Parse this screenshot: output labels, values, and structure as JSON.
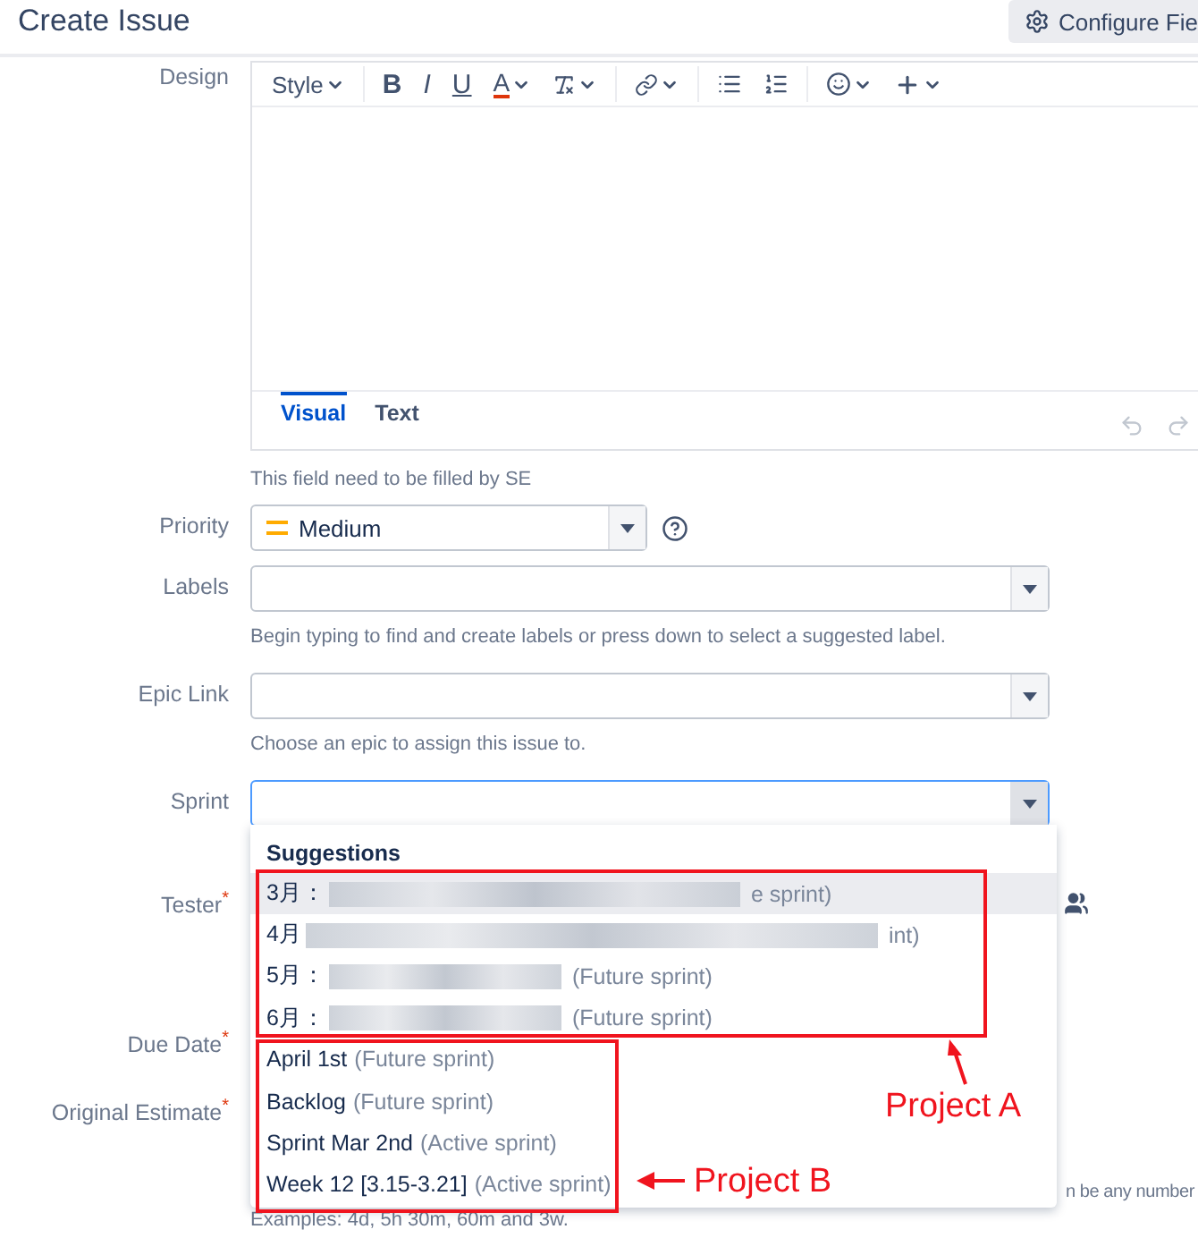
{
  "header": {
    "title": "Create Issue",
    "configure_button": "Configure Fie"
  },
  "design": {
    "label": "Design",
    "toolbar": {
      "style": "Style",
      "bold": "B",
      "italic": "I",
      "underline": "U",
      "font_color": "A"
    },
    "tabs": [
      {
        "label": "Visual",
        "selected": true
      },
      {
        "label": "Text",
        "selected": false
      }
    ],
    "hint": "This field need to be filled by SE"
  },
  "fields": [
    {
      "kind": "short_select",
      "label": "Priority",
      "value": "Medium",
      "help": true,
      "focused": false
    },
    {
      "kind": "select",
      "label": "Labels",
      "hint": "Begin typing to find and create labels or press down to select a suggested label.",
      "focused": false
    },
    {
      "kind": "select",
      "label": "Epic Link",
      "hint": "Choose an epic to assign this issue to.",
      "focused": false
    },
    {
      "kind": "select",
      "label": "Sprint",
      "focused": true
    },
    {
      "kind": "user",
      "label": "Tester",
      "required_mark": "*"
    },
    {
      "kind": "date",
      "label": "Due Date",
      "required_mark": "*"
    },
    {
      "kind": "estimate",
      "label": "Original Estimate",
      "required_mark": "*",
      "hint_tail": "n be any number",
      "hint": "Examples: 4d, 5h 30m, 60m and 3w."
    }
  ],
  "suggestions": {
    "heading": "Suggestions",
    "items": [
      {
        "name": "3月：",
        "blurred": true,
        "detail": "e sprint)",
        "selected": true
      },
      {
        "name": "4月",
        "blurred": true,
        "detail": "int)",
        "selected": false
      },
      {
        "name": "5月：",
        "blurred": true,
        "detail": "(Future sprint)",
        "selected": false
      },
      {
        "name": "6月：",
        "blurred": true,
        "detail": "(Future sprint)",
        "selected": false
      },
      {
        "name": "April 1st",
        "blurred": false,
        "detail": "(Future sprint)",
        "selected": false
      },
      {
        "name": "Backlog",
        "blurred": false,
        "detail": "(Future sprint)",
        "selected": false
      },
      {
        "name": "Sprint Mar 2nd",
        "blurred": false,
        "detail": "(Active sprint)",
        "selected": false
      },
      {
        "name": "Week 12 [3.15-3.21]",
        "blurred": false,
        "detail": "(Active sprint)",
        "selected": false
      }
    ]
  },
  "annotations": [
    {
      "label": "Project A"
    },
    {
      "label": "Project B"
    }
  ]
}
